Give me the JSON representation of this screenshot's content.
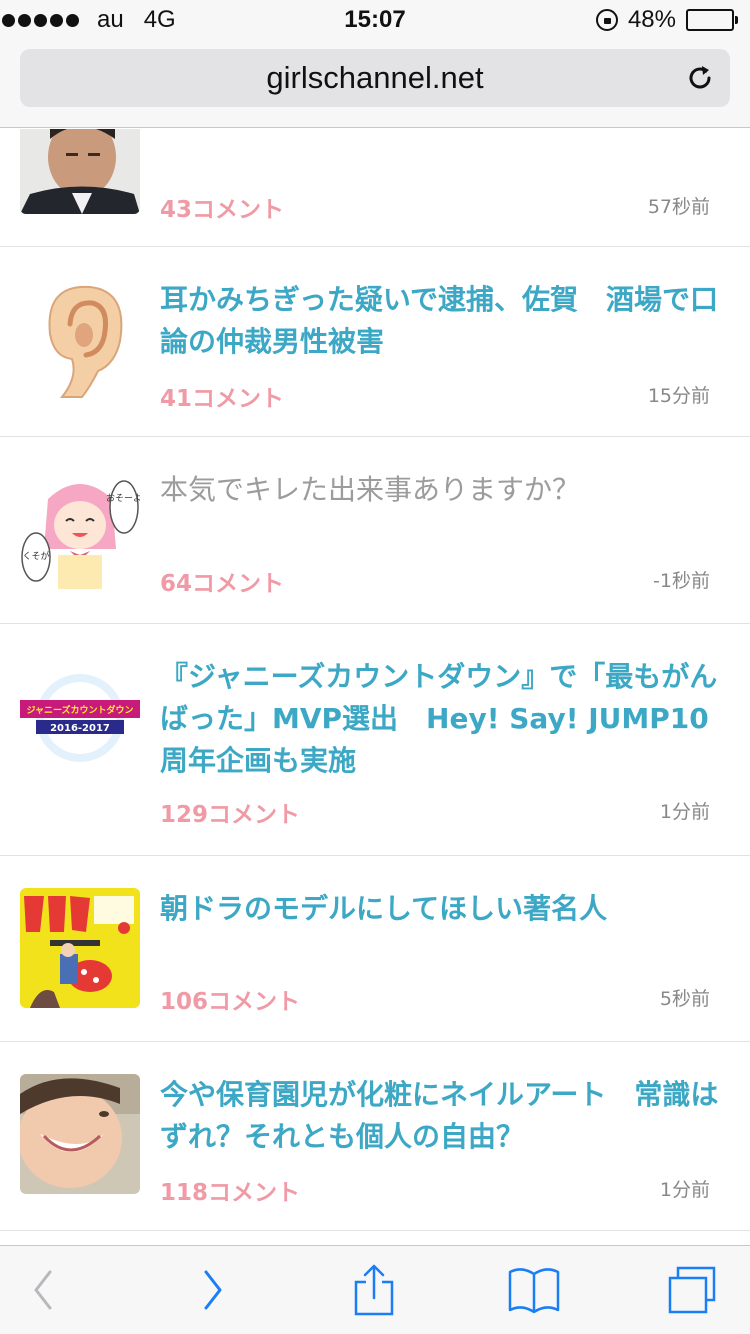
{
  "status_bar": {
    "carrier": "au",
    "network": "4G",
    "time": "15:07",
    "battery": "48%",
    "battery_level": 0.48
  },
  "address_bar": {
    "url": "girlschannel.net"
  },
  "topics": [
    {
      "title": "",
      "comments": "43コメント",
      "time": "57秒前",
      "thumb": "man-in-suit-photo"
    },
    {
      "title": "耳かみちぎった疑いで逮捕、佐賀　酒場で口論の仲裁男性被害",
      "comments": "41コメント",
      "time": "15分前",
      "thumb": "ear-illustration"
    },
    {
      "title": "本気でキレた出来事ありますか？",
      "comments": "64コメント",
      "time": "-1秒前",
      "thumb": "anime-girl-illustration",
      "manga_text_1": "おそーよ",
      "manga_text_2": "くそが"
    },
    {
      "title": "『ジャニーズカウントダウン』で「最もがんばった」MVP選出　Hey! Say! JUMP10周年企画も実施",
      "comments": "129コメント",
      "time": "1分前",
      "thumb": "countdown-logo",
      "logo_text": "ジャニーズカウントダウン",
      "logo_years": "2016-2017"
    },
    {
      "title": "朝ドラのモデルにしてほしい著名人",
      "comments": "106コメント",
      "time": "5秒前",
      "thumb": "manga-cover"
    },
    {
      "title": "今や保育園児が化粧にネイルアート　常識はずれ？それとも個人の自由？",
      "comments": "118コメント",
      "time": "1分前",
      "thumb": "child-photo"
    }
  ],
  "colors": {
    "title": "#3ca8c5",
    "title_visited": "#9c9c9c",
    "comments": "#f09aa6",
    "ios_blue": "#1a7ef5"
  },
  "toolbar": {
    "back": "back-chevron-icon",
    "forward": "forward-chevron-icon",
    "share": "share-icon",
    "bookmarks": "book-icon",
    "tabs": "tabs-icon"
  }
}
